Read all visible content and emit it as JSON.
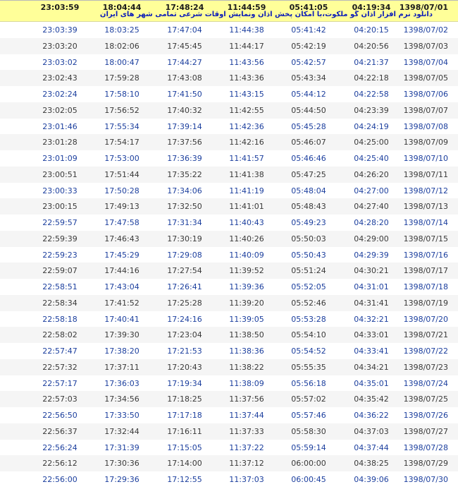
{
  "header": {
    "times": [
      "23:03:59",
      "18:04:44",
      "17:48:24",
      "11:44:59",
      "05:41:05",
      "04:19:34"
    ],
    "date": "1398/07/01",
    "banner": "دانلود نرم افزار اذان گو ملکوت،با امکان پخش اذان ونمایش اوقات شرعی تمامی شهر های ایران"
  },
  "rows": [
    {
      "c": [
        "23:03:39",
        "18:03:25",
        "17:47:04",
        "11:44:38",
        "05:41:42",
        "04:20:15",
        "1398/07/02"
      ],
      "linked": true
    },
    {
      "c": [
        "23:03:20",
        "18:02:06",
        "17:45:45",
        "11:44:17",
        "05:42:19",
        "04:20:56",
        "1398/07/03"
      ],
      "linked": false
    },
    {
      "c": [
        "23:03:02",
        "18:00:47",
        "17:44:27",
        "11:43:56",
        "05:42:57",
        "04:21:37",
        "1398/07/04"
      ],
      "linked": true
    },
    {
      "c": [
        "23:02:43",
        "17:59:28",
        "17:43:08",
        "11:43:36",
        "05:43:34",
        "04:22:18",
        "1398/07/05"
      ],
      "linked": false
    },
    {
      "c": [
        "23:02:24",
        "17:58:10",
        "17:41:50",
        "11:43:15",
        "05:44:12",
        "04:22:58",
        "1398/07/06"
      ],
      "linked": true
    },
    {
      "c": [
        "23:02:05",
        "17:56:52",
        "17:40:32",
        "11:42:55",
        "05:44:50",
        "04:23:39",
        "1398/07/07"
      ],
      "linked": false
    },
    {
      "c": [
        "23:01:46",
        "17:55:34",
        "17:39:14",
        "11:42:36",
        "05:45:28",
        "04:24:19",
        "1398/07/08"
      ],
      "linked": true
    },
    {
      "c": [
        "23:01:28",
        "17:54:17",
        "17:37:56",
        "11:42:16",
        "05:46:07",
        "04:25:00",
        "1398/07/09"
      ],
      "linked": false
    },
    {
      "c": [
        "23:01:09",
        "17:53:00",
        "17:36:39",
        "11:41:57",
        "05:46:46",
        "04:25:40",
        "1398/07/10"
      ],
      "linked": true
    },
    {
      "c": [
        "23:00:51",
        "17:51:44",
        "17:35:22",
        "11:41:38",
        "05:47:25",
        "04:26:20",
        "1398/07/11"
      ],
      "linked": false
    },
    {
      "c": [
        "23:00:33",
        "17:50:28",
        "17:34:06",
        "11:41:19",
        "05:48:04",
        "04:27:00",
        "1398/07/12"
      ],
      "linked": true
    },
    {
      "c": [
        "23:00:15",
        "17:49:13",
        "17:32:50",
        "11:41:01",
        "05:48:43",
        "04:27:40",
        "1398/07/13"
      ],
      "linked": false
    },
    {
      "c": [
        "22:59:57",
        "17:47:58",
        "17:31:34",
        "11:40:43",
        "05:49:23",
        "04:28:20",
        "1398/07/14"
      ],
      "linked": true
    },
    {
      "c": [
        "22:59:39",
        "17:46:43",
        "17:30:19",
        "11:40:26",
        "05:50:03",
        "04:29:00",
        "1398/07/15"
      ],
      "linked": false
    },
    {
      "c": [
        "22:59:23",
        "17:45:29",
        "17:29:08",
        "11:40:09",
        "05:50:43",
        "04:29:39",
        "1398/07/16"
      ],
      "linked": true
    },
    {
      "c": [
        "22:59:07",
        "17:44:16",
        "17:27:54",
        "11:39:52",
        "05:51:24",
        "04:30:21",
        "1398/07/17"
      ],
      "linked": false
    },
    {
      "c": [
        "22:58:51",
        "17:43:04",
        "17:26:41",
        "11:39:36",
        "05:52:05",
        "04:31:01",
        "1398/07/18"
      ],
      "linked": true
    },
    {
      "c": [
        "22:58:34",
        "17:41:52",
        "17:25:28",
        "11:39:20",
        "05:52:46",
        "04:31:41",
        "1398/07/19"
      ],
      "linked": false
    },
    {
      "c": [
        "22:58:18",
        "17:40:41",
        "17:24:16",
        "11:39:05",
        "05:53:28",
        "04:32:21",
        "1398/07/20"
      ],
      "linked": true
    },
    {
      "c": [
        "22:58:02",
        "17:39:30",
        "17:23:04",
        "11:38:50",
        "05:54:10",
        "04:33:01",
        "1398/07/21"
      ],
      "linked": false
    },
    {
      "c": [
        "22:57:47",
        "17:38:20",
        "17:21:53",
        "11:38:36",
        "05:54:52",
        "04:33:41",
        "1398/07/22"
      ],
      "linked": true
    },
    {
      "c": [
        "22:57:32",
        "17:37:11",
        "17:20:43",
        "11:38:22",
        "05:55:35",
        "04:34:21",
        "1398/07/23"
      ],
      "linked": false
    },
    {
      "c": [
        "22:57:17",
        "17:36:03",
        "17:19:34",
        "11:38:09",
        "05:56:18",
        "04:35:01",
        "1398/07/24"
      ],
      "linked": true
    },
    {
      "c": [
        "22:57:03",
        "17:34:56",
        "17:18:25",
        "11:37:56",
        "05:57:02",
        "04:35:42",
        "1398/07/25"
      ],
      "linked": false
    },
    {
      "c": [
        "22:56:50",
        "17:33:50",
        "17:17:18",
        "11:37:44",
        "05:57:46",
        "04:36:22",
        "1398/07/26"
      ],
      "linked": true
    },
    {
      "c": [
        "22:56:37",
        "17:32:44",
        "17:16:11",
        "11:37:33",
        "05:58:30",
        "04:37:03",
        "1398/07/27"
      ],
      "linked": false
    },
    {
      "c": [
        "22:56:24",
        "17:31:39",
        "17:15:05",
        "11:37:22",
        "05:59:14",
        "04:37:44",
        "1398/07/28"
      ],
      "linked": true
    },
    {
      "c": [
        "22:56:12",
        "17:30:36",
        "17:14:00",
        "11:37:12",
        "06:00:00",
        "04:38:25",
        "1398/07/29"
      ],
      "linked": false
    },
    {
      "c": [
        "22:56:00",
        "17:29:36",
        "17:12:55",
        "11:37:03",
        "06:00:45",
        "04:39:06",
        "1398/07/30"
      ],
      "linked": true
    }
  ]
}
